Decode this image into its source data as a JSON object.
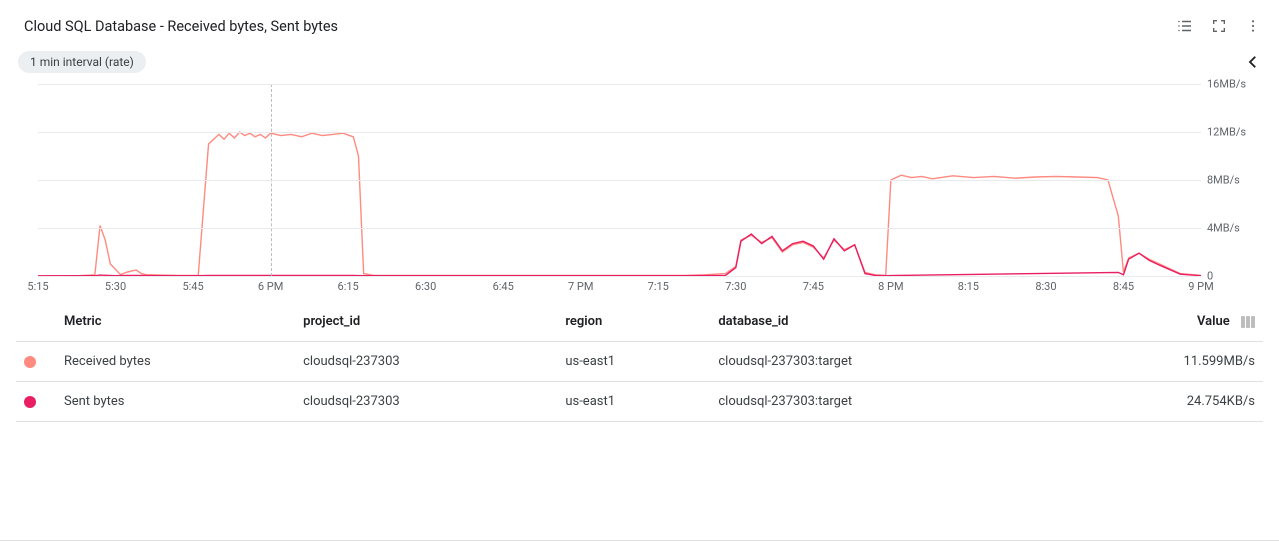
{
  "title": "Cloud SQL Database - Received bytes, Sent bytes",
  "chip": "1 min interval (rate)",
  "colors": {
    "received": "#ff8a80",
    "sent": "#e91e63"
  },
  "icons": {
    "legend": "list-icon",
    "fullscreen": "fullscreen-icon",
    "more": "more-vert-icon",
    "collapse": "chevron-left-icon",
    "columns": "columns-icon"
  },
  "chart_data": {
    "type": "line",
    "title": "Cloud SQL Database - Received bytes, Sent bytes",
    "xlabel": "",
    "ylabel": "",
    "x_ticks": [
      "5:15",
      "5:30",
      "5:45",
      "6 PM",
      "6:15",
      "6:30",
      "6:45",
      "7 PM",
      "7:15",
      "7:30",
      "7:45",
      "8 PM",
      "8:15",
      "8:30",
      "8:45",
      "9 PM"
    ],
    "x_range_minutes": [
      315,
      540
    ],
    "y_ticks_mb_s": [
      0,
      4,
      8,
      12,
      16
    ],
    "y_tick_labels": [
      "0",
      "4MB/s",
      "8MB/s",
      "12MB/s",
      "16MB/s"
    ],
    "ylim": [
      0,
      16
    ],
    "cursor_at_minute": 360,
    "series": [
      {
        "name": "Received bytes",
        "color": "#ff8a80",
        "x_minutes": [
          315,
          322,
          326,
          327,
          328,
          329,
          331,
          332,
          333,
          334,
          335,
          336,
          337,
          342,
          346,
          348,
          350,
          351,
          352,
          353,
          354,
          355,
          356,
          357,
          358,
          359,
          360,
          362,
          364,
          366,
          368,
          370,
          372,
          374,
          376,
          377,
          378,
          380,
          440,
          444,
          448,
          450,
          451,
          453,
          455,
          457,
          459,
          461,
          463,
          465,
          467,
          469,
          471,
          473,
          475,
          477,
          479,
          480,
          482,
          484,
          486,
          488,
          492,
          496,
          500,
          504,
          508,
          512,
          516,
          520,
          522,
          524,
          525,
          526,
          528,
          530,
          532,
          536,
          540
        ],
        "y_mb_s": [
          0.0,
          0.0,
          0.1,
          4.2,
          3.0,
          1.0,
          0.1,
          0.3,
          0.4,
          0.5,
          0.2,
          0.1,
          0.1,
          0.05,
          0.05,
          11.0,
          11.8,
          11.4,
          11.9,
          11.5,
          12.0,
          11.7,
          11.9,
          11.6,
          11.8,
          11.5,
          11.9,
          11.7,
          11.8,
          11.6,
          11.9,
          11.7,
          11.8,
          11.9,
          11.6,
          10.0,
          0.2,
          0.05,
          0.05,
          0.1,
          0.2,
          0.8,
          3.0,
          3.4,
          2.8,
          3.2,
          2.0,
          2.6,
          2.8,
          2.4,
          1.5,
          3.0,
          2.2,
          2.6,
          0.3,
          0.1,
          0.05,
          8.0,
          8.4,
          8.2,
          8.3,
          8.1,
          8.35,
          8.2,
          8.3,
          8.15,
          8.25,
          8.3,
          8.25,
          8.2,
          8.0,
          5.0,
          0.3,
          1.5,
          1.9,
          1.4,
          1.0,
          0.2,
          0.05
        ]
      },
      {
        "name": "Sent bytes",
        "color": "#e91e63",
        "x_minutes": [
          315,
          326,
          327,
          328,
          330,
          334,
          338,
          346,
          348,
          376,
          378,
          440,
          448,
          450,
          451,
          453,
          455,
          457,
          459,
          461,
          463,
          465,
          467,
          469,
          471,
          473,
          475,
          477,
          479,
          524,
          525,
          526,
          528,
          530,
          532,
          536,
          540
        ],
        "y_mb_s": [
          0.01,
          0.02,
          0.08,
          0.06,
          0.03,
          0.05,
          0.03,
          0.02,
          0.05,
          0.05,
          0.02,
          0.02,
          0.05,
          0.7,
          2.9,
          3.5,
          2.7,
          3.3,
          2.1,
          2.7,
          2.9,
          2.5,
          1.4,
          3.1,
          2.1,
          2.6,
          0.2,
          0.05,
          0.03,
          0.3,
          0.1,
          1.4,
          1.9,
          1.3,
          0.9,
          0.15,
          0.03
        ]
      }
    ]
  },
  "table": {
    "headers": {
      "metric": "Metric",
      "project_id": "project_id",
      "region": "region",
      "database_id": "database_id",
      "value": "Value"
    },
    "rows": [
      {
        "swatch": "#ff8a80",
        "metric": "Received bytes",
        "project_id": "cloudsql-237303",
        "region": "us-east1",
        "database_id": "cloudsql-237303:target",
        "value": "11.599MB/s"
      },
      {
        "swatch": "#e91e63",
        "metric": "Sent bytes",
        "project_id": "cloudsql-237303",
        "region": "us-east1",
        "database_id": "cloudsql-237303:target",
        "value": "24.754KB/s"
      }
    ]
  }
}
